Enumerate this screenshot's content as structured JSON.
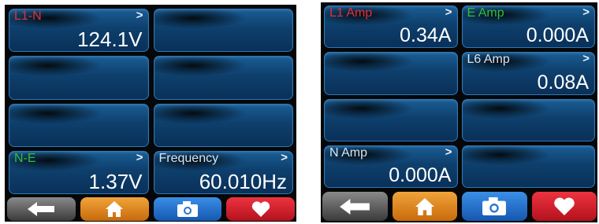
{
  "left_screen": {
    "tiles": [
      {
        "label": "L1-N",
        "label_color": "#e0303a",
        "value": "124.1V",
        "arrow": ">"
      },
      {
        "label": "",
        "label_color": "#ffffff",
        "value": "",
        "arrow": ""
      },
      {
        "label": "",
        "label_color": "#ffffff",
        "value": "",
        "arrow": ""
      },
      {
        "label": "",
        "label_color": "#ffffff",
        "value": "",
        "arrow": ""
      },
      {
        "label": "",
        "label_color": "#ffffff",
        "value": "",
        "arrow": ""
      },
      {
        "label": "",
        "label_color": "#ffffff",
        "value": "",
        "arrow": ""
      },
      {
        "label": "N-E",
        "label_color": "#2fbf3a",
        "value": "1.37V",
        "arrow": ">"
      },
      {
        "label": "Frequency",
        "label_color": "#d8e4f0",
        "value": "60.010Hz",
        "arrow": ">"
      }
    ],
    "buttons": [
      {
        "icon": "back-arrow-icon",
        "color": "#5a5a5a"
      },
      {
        "icon": "home-icon",
        "color": "#e08a20"
      },
      {
        "icon": "camera-icon",
        "color": "#2a74cc"
      },
      {
        "icon": "heart-icon",
        "color": "#d8222c"
      }
    ]
  },
  "right_screen": {
    "tiles": [
      {
        "label": "L1 Amp",
        "label_color": "#e0303a",
        "value": "0.34A",
        "arrow": ">"
      },
      {
        "label": "E Amp",
        "label_color": "#2fbf3a",
        "value": "0.000A",
        "arrow": ">"
      },
      {
        "label": "",
        "label_color": "#ffffff",
        "value": "",
        "arrow": ""
      },
      {
        "label": "L6 Amp",
        "label_color": "#d8e4f0",
        "value": "0.08A",
        "arrow": ">"
      },
      {
        "label": "",
        "label_color": "#ffffff",
        "value": "",
        "arrow": ""
      },
      {
        "label": "",
        "label_color": "#ffffff",
        "value": "",
        "arrow": ""
      },
      {
        "label": "N Amp",
        "label_color": "#d8e4f0",
        "value": "0.000A",
        "arrow": ">"
      },
      {
        "label": "",
        "label_color": "#ffffff",
        "value": "",
        "arrow": ""
      }
    ],
    "buttons": [
      {
        "icon": "back-arrow-icon",
        "color": "#5a5a5a"
      },
      {
        "icon": "home-icon",
        "color": "#e08a20"
      },
      {
        "icon": "camera-icon",
        "color": "#2a74cc"
      },
      {
        "icon": "heart-icon",
        "color": "#d8222c"
      }
    ]
  }
}
